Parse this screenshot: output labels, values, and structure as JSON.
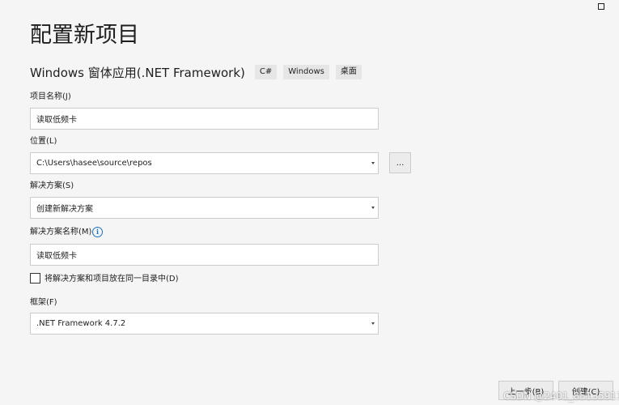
{
  "page_title": "配置新项目",
  "template": {
    "name": "Windows 窗体应用(.NET Framework)",
    "tags": [
      "C#",
      "Windows",
      "桌面"
    ]
  },
  "project_name": {
    "label": "项目名称(J)",
    "value": "读取低频卡"
  },
  "location": {
    "label": "位置(L)",
    "value": "C:\\Users\\hasee\\source\\repos",
    "browse_label": "..."
  },
  "solution": {
    "label": "解决方案(S)",
    "value": "创建新解决方案"
  },
  "solution_name": {
    "label": "解决方案名称(M)",
    "value": "读取低频卡",
    "info_symbol": "i"
  },
  "same_dir_checkbox": {
    "label": "将解决方案和项目放在同一目录中(D)",
    "checked": false
  },
  "framework": {
    "label": "框架(F)",
    "value": ".NET Framework 4.7.2"
  },
  "footer": {
    "back_label": "上一步(B)",
    "create_label": "创建(C)"
  },
  "watermark": "CSDN @2401_85135911"
}
